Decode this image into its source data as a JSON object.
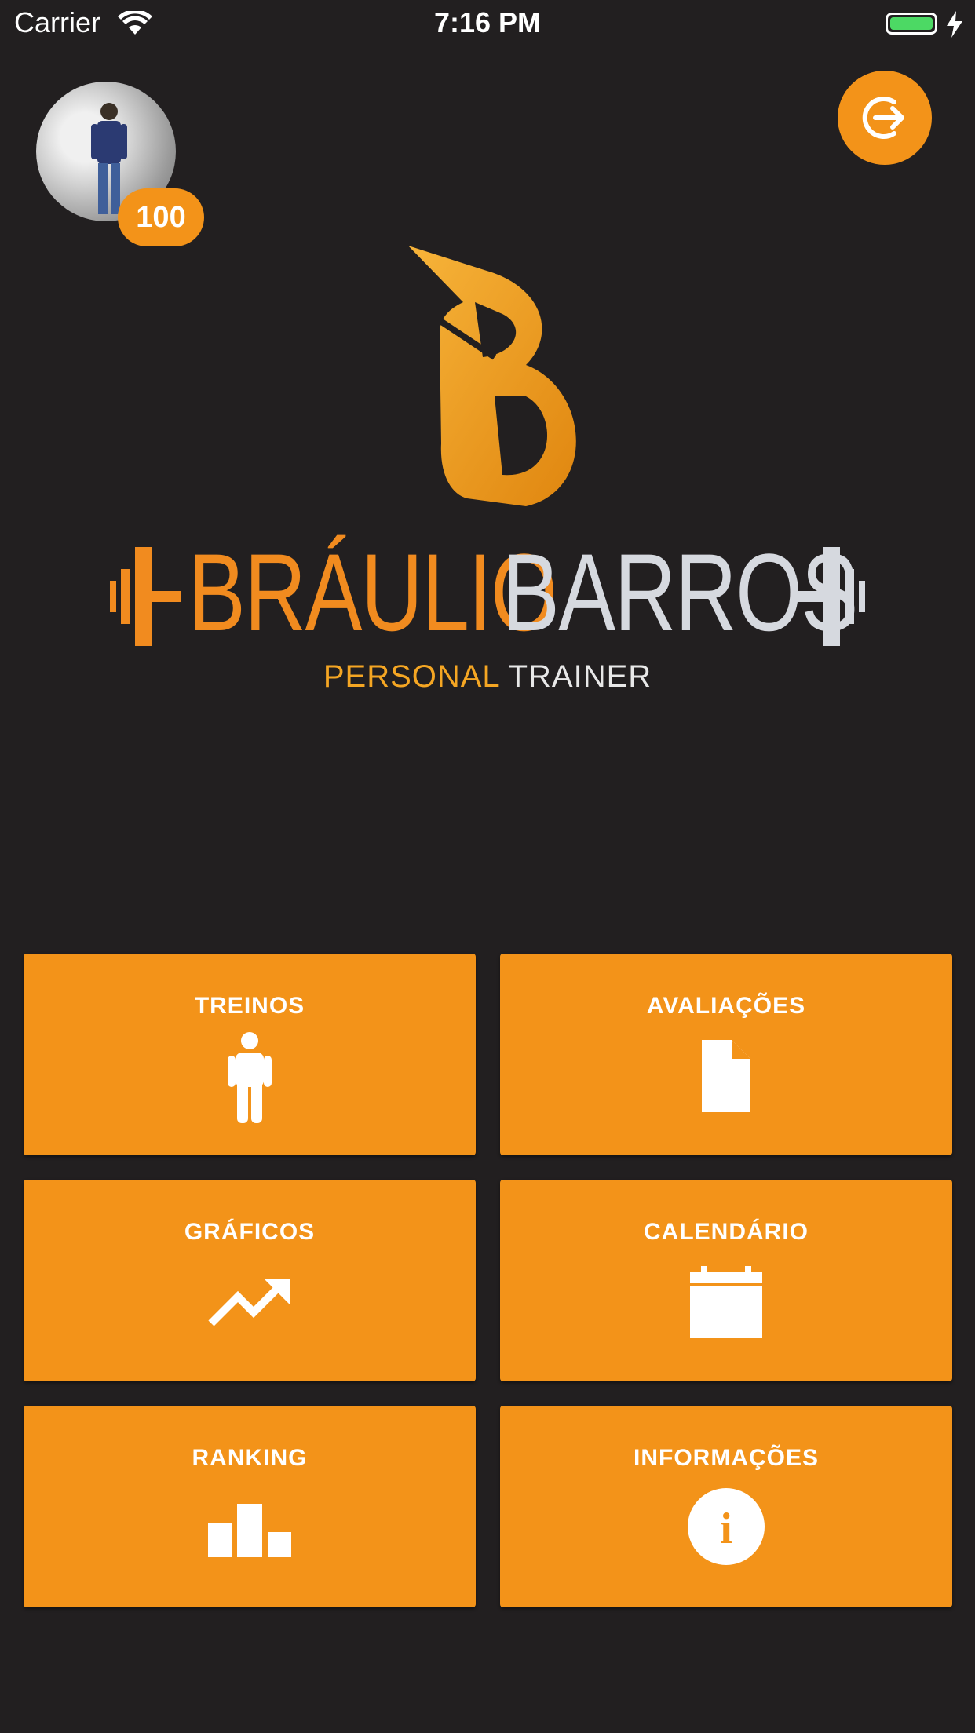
{
  "status_bar": {
    "carrier": "Carrier",
    "time": "7:16 PM",
    "battery_level": 1.0
  },
  "header": {
    "score": "100",
    "avatar_icon": "user-photo",
    "logout_icon": "logout-icon"
  },
  "logo": {
    "first_name": "BRÁULIO",
    "last_name": "BARROS",
    "subtitle_personal": "PERSONAL",
    "subtitle_trainer": "TRAINER"
  },
  "menu": {
    "items": [
      {
        "label": "TREINOS",
        "icon": "person-icon"
      },
      {
        "label": "AVALIAÇÕES",
        "icon": "document-icon"
      },
      {
        "label": "GRÁFICOS",
        "icon": "trending-up-icon"
      },
      {
        "label": "CALENDÁRIO",
        "icon": "calendar-icon"
      },
      {
        "label": "RANKING",
        "icon": "ranking-bars-icon"
      },
      {
        "label": "INFORMAÇÕES",
        "icon": "info-icon"
      }
    ]
  },
  "colors": {
    "background": "#221f20",
    "accent": "#f39319",
    "logo_orange": "#f18b1f",
    "logo_silver": "#d6d9df"
  }
}
